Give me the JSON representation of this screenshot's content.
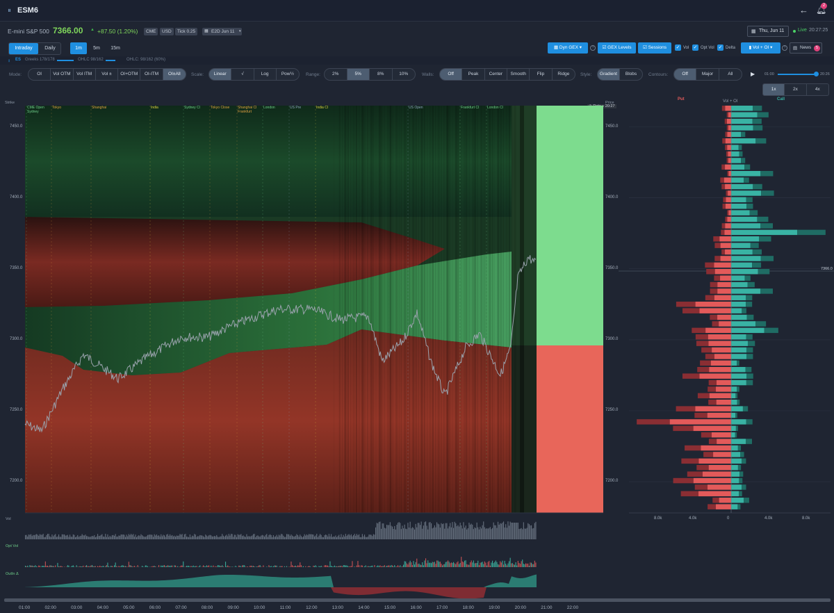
{
  "app": {
    "logo_glyph": "⏸",
    "symbol": "ESM6",
    "notif_count": "2"
  },
  "quote": {
    "name": "E-mini S&P 500",
    "price": "7366.00",
    "change": "+87.50 (1.20%)",
    "exchange": "CME",
    "currency": "USD",
    "tick": "Tick 0.25",
    "expiry": "E2D Jun 11",
    "date": "Thu, Jun 11",
    "live": "Live",
    "time": "20:27:25"
  },
  "tabs": {
    "intraday": "Intraday",
    "daily": "Daily",
    "tf": [
      "1m",
      "5m",
      "15m"
    ]
  },
  "toolbar": {
    "dyn_gex": "Dyn GEX",
    "gex_levels": "GEX Levels",
    "sessions": "Sessions",
    "vol": "Vol",
    "opt_vol": "Opt Vol",
    "delta": "Delta",
    "vol_oi": "Vol + OI",
    "news": "News",
    "news_count": "5"
  },
  "status": {
    "sym": "ES",
    "greeks": "Greeks 178/178",
    "ohlc1": "OHLC 98/162",
    "ohlc2": "OHLC: 98/162 (60%)"
  },
  "controls": {
    "mode_label": "Mode:",
    "mode": [
      "OI",
      "Vol OTM",
      "Vol ITM",
      "Vol ±",
      "OI+OTM",
      "OI-ITM",
      "OI±All"
    ],
    "scale_label": "Scale:",
    "scale": [
      "Linear",
      "√",
      "Log",
      "Pow½"
    ],
    "range_label": "Range:",
    "range": [
      "2%",
      "5%",
      "8%",
      "10%"
    ],
    "walls_label": "Walls:",
    "walls": [
      "Off",
      "Peak",
      "Center",
      "Smooth",
      "Flip",
      "Ridge"
    ],
    "style_label": "Style:",
    "style": [
      "Gradient",
      "Blobs"
    ],
    "contours_label": "Contours:",
    "contours": [
      "Off",
      "Major",
      "All"
    ],
    "play_start": "01:00",
    "play_end": "20:26",
    "speed": [
      "1x",
      "2x",
      "4x"
    ]
  },
  "chart": {
    "strike_label": "Strike",
    "price_label": "Price",
    "date_label": "Date",
    "date_time": "20:27",
    "y_ticks": [
      "7450.0",
      "7400.0",
      "7350.0",
      "7300.0",
      "7250.0",
      "7200.0"
    ],
    "x_ticks": [
      "01:00",
      "02:00",
      "03:00",
      "04:00",
      "05:00",
      "06:00",
      "07:00",
      "08:00",
      "09:00",
      "10:00",
      "11:00",
      "12:00",
      "13:00",
      "14:00",
      "15:00",
      "16:00",
      "17:00",
      "18:00",
      "19:00",
      "20:00",
      "21:00",
      "22:00"
    ],
    "sessions": [
      {
        "label": "CME Open\nSydney",
        "color": "#6fd08a"
      },
      {
        "label": "Tokyo",
        "color": "#e0a040"
      },
      {
        "label": "Shanghai",
        "color": "#e0a040"
      },
      {
        "label": "India",
        "color": "#e0d040"
      },
      {
        "label": "Sydney Cl",
        "color": "#6fd08a"
      },
      {
        "label": "Tokyo Close",
        "color": "#e0a040"
      },
      {
        "label": "Shanghai Cl\nFrankfurt",
        "color": "#e0a040"
      },
      {
        "label": "London",
        "color": "#6fd08a"
      },
      {
        "label": "US Pre",
        "color": "#8ea4c0"
      },
      {
        "label": "India Cl",
        "color": "#e0d040"
      },
      {
        "label": "US Open",
        "color": "#8ea4c0"
      },
      {
        "label": "Frankfurt Cl",
        "color": "#6fd08a"
      },
      {
        "label": "London Cl",
        "color": "#6fd08a"
      }
    ],
    "sub_labels": {
      "vol": "Vol",
      "opt_vol": "Opt Vol",
      "oi_delta": "OutIn Δ"
    }
  },
  "profile": {
    "put_label": "Put",
    "call_label": "Call",
    "title": "Vol + OI",
    "current_price": "7366.0",
    "x_ticks": [
      "8.0k",
      "4.0k",
      "0",
      "4.0k",
      "8.0k"
    ],
    "colors": {
      "put": "#e35a5a",
      "put_dark": "#8a2e33",
      "call": "#39b3a4",
      "call_dark": "#1f6c64"
    }
  }
}
